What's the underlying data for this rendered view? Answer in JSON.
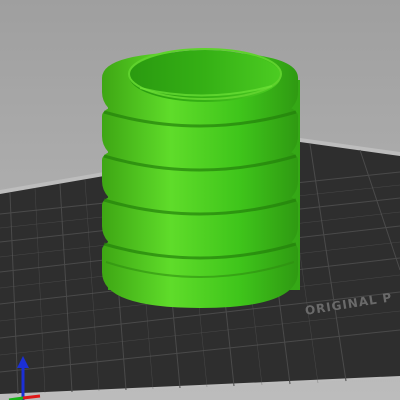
{
  "app": {
    "background_color": "#ababab"
  },
  "bed": {
    "label": "ORIGINAL P",
    "surface_color": "#2e2e2e",
    "grid_color": "#4a4a4a",
    "edge_color": "#bdbdbd"
  },
  "model": {
    "color": "#3fc51b",
    "shape": "ribbed-cylinder",
    "ring_count": 5
  },
  "axes": {
    "x_axis_color": "#e01818",
    "y_axis_color": "#1b2fd6",
    "z_axis_color": "#18b418"
  }
}
